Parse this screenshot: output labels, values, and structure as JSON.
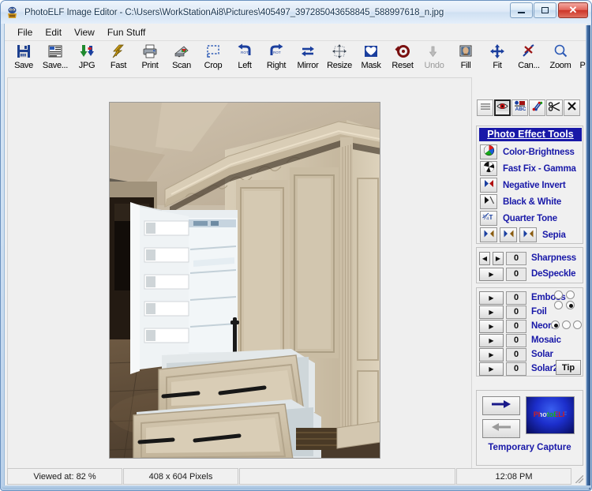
{
  "window": {
    "title": "PhotoELF Image Editor - C:\\Users\\WorkStationAi8\\Pictures\\405497_397285043658845_588997618_n.jpg",
    "app_icon": "photoelf-icon",
    "minimize_label": "–",
    "maximize_label": "❐",
    "close_label": "✕",
    "accent_blue": "#1818a8",
    "titlebar_color": "#cfe0f2"
  },
  "menubar": {
    "items": [
      {
        "label": "File"
      },
      {
        "label": "Edit"
      },
      {
        "label": "View"
      },
      {
        "label": "Fun Stuff"
      }
    ]
  },
  "toolbar": {
    "buttons": [
      {
        "label": "Save",
        "icon": "floppy-disk-icon",
        "disabled": false
      },
      {
        "label": "Save...",
        "icon": "save-as-icon",
        "disabled": false
      },
      {
        "label": "JPG",
        "icon": "jpg-download-icon",
        "disabled": false
      },
      {
        "label": "Fast",
        "icon": "lightning-fast-icon",
        "disabled": false
      },
      {
        "label": "Print",
        "icon": "printer-icon",
        "disabled": false
      },
      {
        "label": "Scan",
        "icon": "scanner-icon",
        "disabled": false
      },
      {
        "label": "Crop",
        "icon": "crop-marquee-icon",
        "disabled": false
      },
      {
        "label": "Left",
        "icon": "rotate-left-icon",
        "disabled": false
      },
      {
        "label": "Right",
        "icon": "rotate-right-icon",
        "disabled": false
      },
      {
        "label": "Mirror",
        "icon": "mirror-arrows-icon",
        "disabled": false
      },
      {
        "label": "Resize",
        "icon": "resize-grid-icon",
        "disabled": false
      },
      {
        "label": "Mask",
        "icon": "mask-heart-icon",
        "disabled": false
      },
      {
        "label": "Reset",
        "icon": "reset-undo-icon",
        "disabled": false
      },
      {
        "label": "Undo",
        "icon": "undo-arrow-icon",
        "disabled": true
      },
      {
        "label": "Fill",
        "icon": "fill-photo-icon",
        "disabled": false
      },
      {
        "label": "Fit",
        "icon": "fit-move-icon",
        "disabled": false
      },
      {
        "label": "Can...",
        "icon": "cancel-x-icon",
        "disabled": false
      },
      {
        "label": "Zoom",
        "icon": "magnifier-icon",
        "disabled": false
      },
      {
        "label": "P",
        "icon": "print-partial-icon",
        "disabled": false
      }
    ]
  },
  "canvas": {
    "image_alt": "built-in refrigerator with cream cabinet panel doors and open drawers",
    "background": "#efefef"
  },
  "panel": {
    "icon_row": [
      {
        "icon": "menu-lines-icon",
        "active": false
      },
      {
        "icon": "red-eye-icon",
        "active": true
      },
      {
        "icon": "abc-text-icon",
        "active": false
      },
      {
        "icon": "paint-splash-icon",
        "active": false
      },
      {
        "icon": "scissors-icon",
        "active": false
      },
      {
        "icon": "close-x-icon",
        "active": false
      }
    ],
    "effects_title": "Photo Effect Tools",
    "effects": [
      {
        "label": "Color-Brightness",
        "icon": "color-wheel-icon",
        "buttons": 1
      },
      {
        "label": "Fast Fix - Gamma",
        "icon": "gamma-pinwheel-icon",
        "buttons": 1
      },
      {
        "label": "Negative Invert",
        "icon": "invert-arrows-icon",
        "buttons": 1
      },
      {
        "label": "Black & White",
        "icon": "bw-triangle-icon",
        "buttons": 1
      },
      {
        "label": "Quarter Tone",
        "icon": "quarter-tone-icon",
        "buttons": 1
      },
      {
        "label": "Sepia",
        "icon": "sepia-arrows-icon",
        "buttons": 3
      }
    ],
    "sliders_group_1": [
      {
        "label": "Sharpness",
        "value": "0",
        "spinners": [
          "◀",
          "▶"
        ]
      },
      {
        "label": "DeSpeckle",
        "value": "0",
        "spinners": [
          "▶"
        ]
      }
    ],
    "sliders_group_2": [
      {
        "label": "Emboss",
        "value": "0",
        "spinners": [
          "▶"
        ],
        "radios": [
          false,
          false,
          false,
          true
        ],
        "radio_layout": "grid-2x2"
      },
      {
        "label": "Foil",
        "value": "0",
        "spinners": [
          "▶"
        ],
        "radios": [],
        "radio_layout": "none"
      },
      {
        "label": "Neon",
        "value": "0",
        "spinners": [
          "▶"
        ],
        "radios": [
          true,
          false,
          false
        ],
        "radio_layout": "row-3"
      },
      {
        "label": "Mosaic",
        "value": "0",
        "spinners": [
          "▶"
        ],
        "radios": [],
        "radio_layout": "none"
      },
      {
        "label": "Solar",
        "value": "0",
        "spinners": [
          "▶"
        ],
        "radios": [],
        "radio_layout": "none"
      },
      {
        "label": "Solar2",
        "value": "0",
        "spinners": [
          "▶"
        ],
        "radios": [],
        "radio_layout": "none"
      }
    ],
    "tip_button_label": "Tip",
    "capture": {
      "forward_label": "→",
      "back_label": "←",
      "thumbnail_text": "PhotoELF",
      "caption": "Temporary Capture"
    }
  },
  "statusbar": {
    "zoom": "Viewed at: 82 %",
    "dimensions": "408 x 604 Pixels",
    "message": "",
    "time": "12:08 PM"
  }
}
